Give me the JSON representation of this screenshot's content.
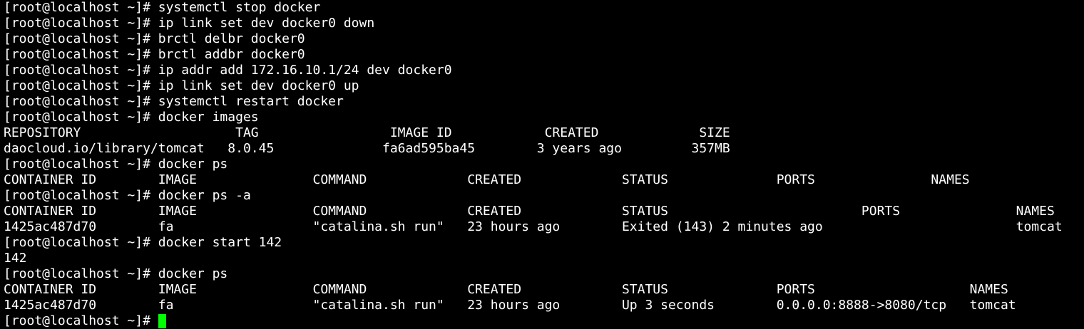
{
  "terminal": {
    "lines": [
      "[root@localhost ~]# systemctl stop docker",
      "[root@localhost ~]# ip link set dev docker0 down",
      "[root@localhost ~]# brctl delbr docker0",
      "[root@localhost ~]# brctl addbr docker0",
      "[root@localhost ~]# ip addr add 172.16.10.1/24 dev docker0",
      "[root@localhost ~]# ip link set dev docker0 up",
      "[root@localhost ~]# systemctl restart docker",
      "[root@localhost ~]# docker images",
      "REPOSITORY                    TAG                 IMAGE ID            CREATED             SIZE",
      "daocloud.io/library/tomcat   8.0.45              fa6ad595ba45        3 years ago         357MB",
      "[root@localhost ~]# docker ps",
      "CONTAINER ID        IMAGE               COMMAND             CREATED             STATUS              PORTS               NAMES",
      "[root@localhost ~]# docker ps -a",
      "CONTAINER ID        IMAGE               COMMAND             CREATED             STATUS                         PORTS               NAMES",
      "1425ac487d70        fa                  \"catalina.sh run\"   23 hours ago        Exited (143) 2 minutes ago                         tomcat",
      "[root@localhost ~]# docker start 142",
      "142",
      "[root@localhost ~]# docker ps",
      "CONTAINER ID        IMAGE               COMMAND             CREATED             STATUS              PORTS                    NAMES",
      "1425ac487d70        fa                  \"catalina.sh run\"   23 hours ago        Up 3 seconds        0.0.0.0:8888->8080/tcp   tomcat"
    ],
    "prompt": "[root@localhost ~]# ",
    "cursor_color": "#00ff00",
    "background": "#000000",
    "foreground": "#ffffff"
  }
}
